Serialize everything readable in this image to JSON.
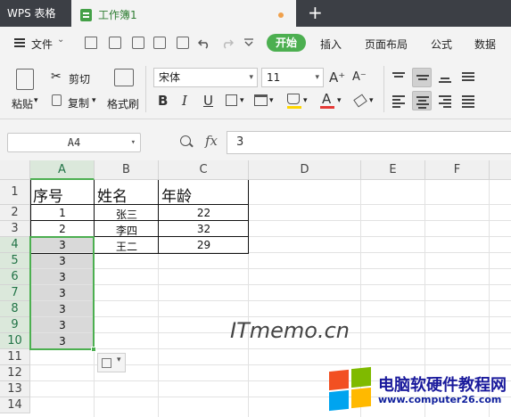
{
  "titlebar": {
    "app_label": "WPS 表格",
    "doc_title": "工作簿1",
    "new_tab_symbol": "+"
  },
  "menu": {
    "file_label": "文件",
    "file_arrow": "⌄",
    "start_label": "开始",
    "tabs": [
      "插入",
      "页面布局",
      "公式",
      "数据"
    ]
  },
  "toolbar": {
    "paste_label": "粘贴",
    "cut_label": "剪切",
    "copy_label": "复制",
    "format_painter_label": "格式刷",
    "font_name": "宋体",
    "font_size": "11",
    "grow_font": "A⁺",
    "shrink_font": "A⁻",
    "bold": "B",
    "italic": "I",
    "underline": "U",
    "font_color_glyph": "A",
    "dropdown_arrow": "▾",
    "colors": {
      "accent": "#4caf50",
      "fill": "#ffd600",
      "font_color": "#e53935"
    }
  },
  "formula_bar": {
    "name_box": "A4",
    "fx_label": "fx",
    "formula_value": "3"
  },
  "sheet": {
    "columns": [
      "A",
      "B",
      "C",
      "D",
      "E",
      "F"
    ],
    "rows": [
      "1",
      "2",
      "3",
      "4",
      "5",
      "6",
      "7",
      "8",
      "9",
      "10",
      "11",
      "12",
      "13",
      "14"
    ],
    "active_cell": "A4",
    "selection": "A4:A10",
    "header": {
      "a": "序号",
      "b": "姓名",
      "c": "年龄"
    },
    "data": [
      {
        "a": "1",
        "b": "张三",
        "c": "22"
      },
      {
        "a": "2",
        "b": "李四",
        "c": "32"
      },
      {
        "a": "3",
        "b": "王二",
        "c": "29"
      },
      {
        "a": "3"
      },
      {
        "a": "3"
      },
      {
        "a": "3"
      },
      {
        "a": "3"
      },
      {
        "a": "3"
      },
      {
        "a": "3"
      }
    ]
  },
  "watermark": {
    "itmemo": "ITmemo.cn",
    "site_name": "电脑软硬件教程网",
    "site_url": "www.computer26.com"
  }
}
